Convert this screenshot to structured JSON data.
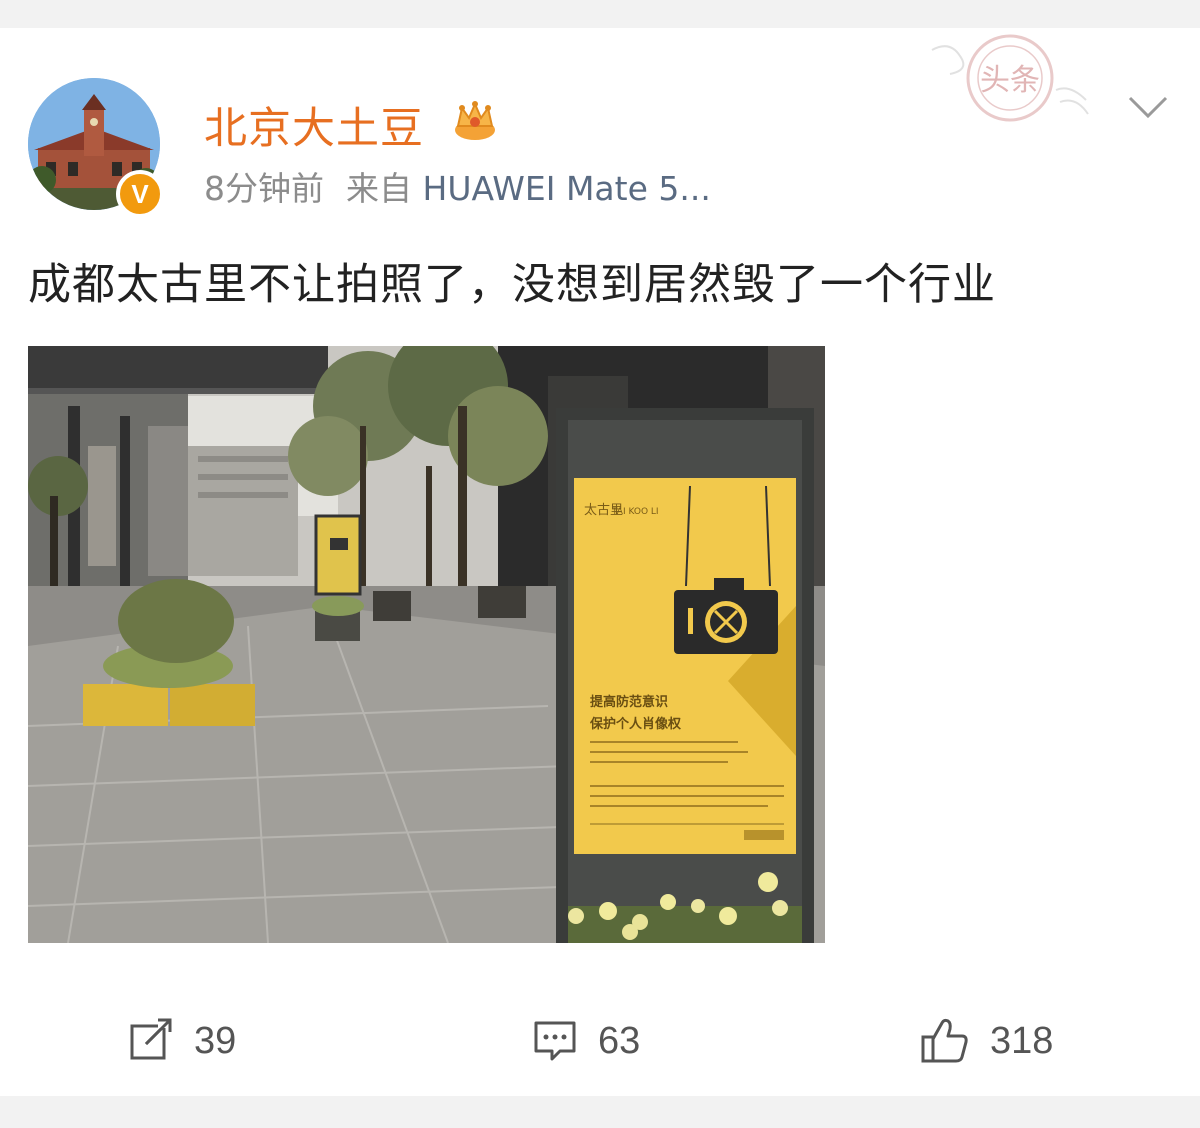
{
  "post": {
    "username": "北京大土豆",
    "time": "8分钟前",
    "source_prefix": "来自",
    "device": "HUAWEI Mate 5...",
    "text": "成都太古里不让拍照了，没想到居然毁了一个行业",
    "verified_badge": "V"
  },
  "photo_sign": {
    "brand_vertical": "太古里",
    "brand_latin": "TAI KOO LI",
    "headline_1": "提高防范意识",
    "headline_2": "保护个人肖像权"
  },
  "stamp": {
    "text": "头条"
  },
  "actions": {
    "repost_count": "39",
    "comment_count": "63",
    "like_count": "318"
  },
  "colors": {
    "username": "#e76f21",
    "verified": "#f29a0e",
    "sign_yellow": "#f2c94c"
  }
}
